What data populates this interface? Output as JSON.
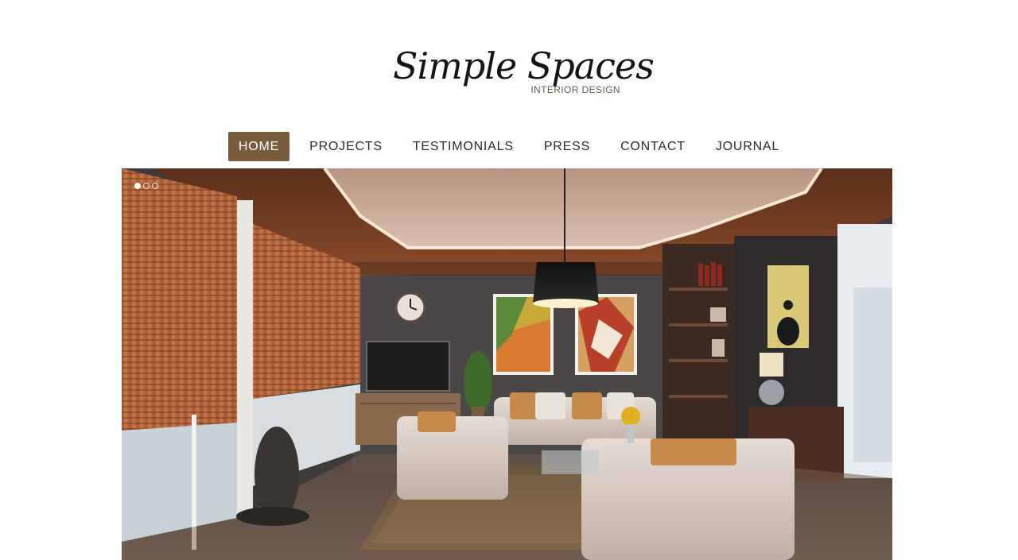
{
  "brand": {
    "logo_script": "Simple Spaces",
    "logo_subtitle": "INTERIOR DESIGN"
  },
  "nav": {
    "items": [
      {
        "label": "HOME",
        "active": true
      },
      {
        "label": "PROJECTS",
        "active": false
      },
      {
        "label": "TESTIMONIALS",
        "active": false
      },
      {
        "label": "PRESS",
        "active": false
      },
      {
        "label": "CONTACT",
        "active": false
      },
      {
        "label": "JOURNAL",
        "active": false
      }
    ],
    "active_color": "#7a5c3e"
  },
  "slider": {
    "slide_count": 3,
    "current_slide": 1
  }
}
